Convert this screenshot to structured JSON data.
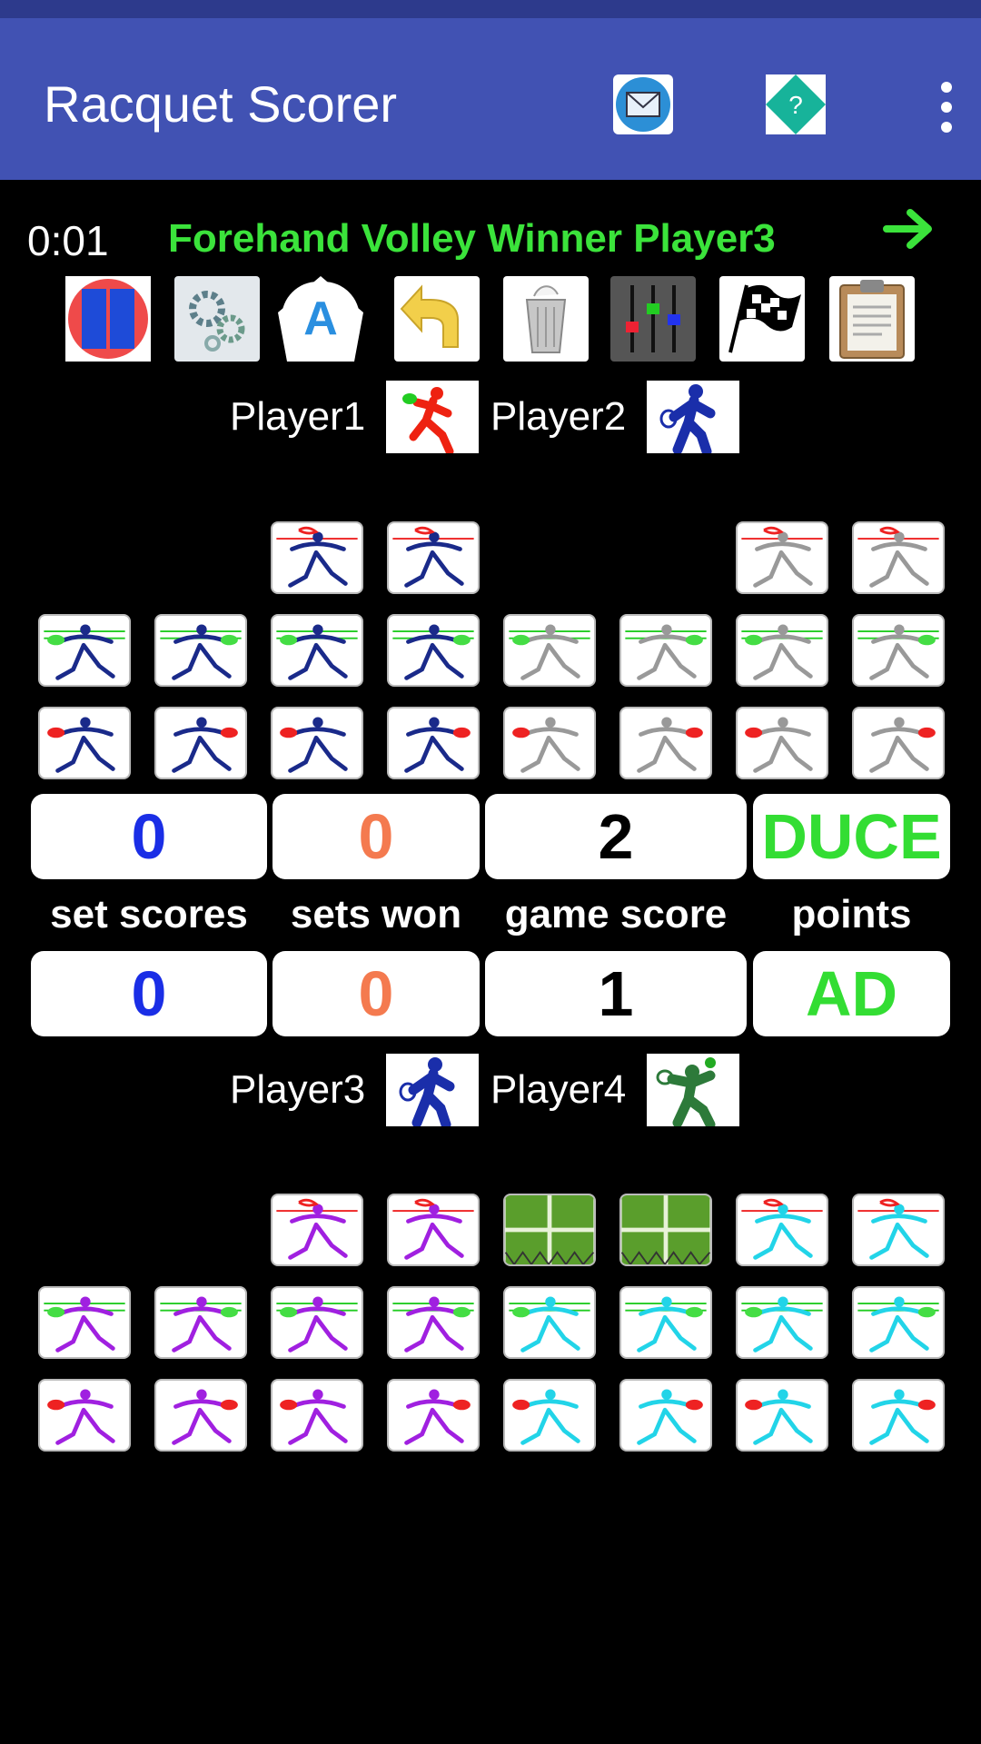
{
  "app": {
    "title": "Racquet Scorer"
  },
  "appbar": {
    "email_icon": "email-icon",
    "help_icon": "help-diamond-icon",
    "menu_icon": "overflow-menu-icon"
  },
  "status": {
    "timer": "0:01",
    "last_action": "Forehand Volley Winner Player3",
    "next_icon": "arrow-right-icon"
  },
  "toolbar": [
    "court-view-icon",
    "settings-gears-icon",
    "auto-a-icon",
    "undo-icon",
    "trash-icon",
    "mixer-sliders-icon",
    "checkered-flag-icon",
    "clipboard-icon"
  ],
  "team1": {
    "player_a": "Player1",
    "player_b": "Player2"
  },
  "team2": {
    "player_a": "Player3",
    "player_b": "Player4"
  },
  "scores": {
    "labels": {
      "set_scores": "set scores",
      "sets_won": "sets won",
      "game_score": "game score",
      "points": "points"
    },
    "team1": {
      "set_scores": "0",
      "sets_won": "0",
      "game_score": "2",
      "points": "DUCE"
    },
    "team2": {
      "set_scores": "0",
      "sets_won": "0",
      "game_score": "1",
      "points": "AD"
    }
  },
  "colors": {
    "appbar": "#4152b3",
    "action_text": "#3be33b",
    "set_scores": "#1a2ee6",
    "sets_won": "#f47a4f",
    "game_score": "#000000",
    "points": "#33dd33"
  }
}
